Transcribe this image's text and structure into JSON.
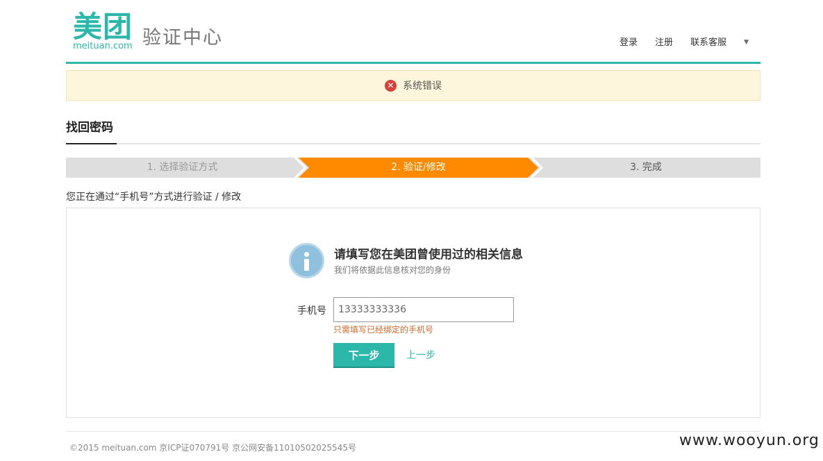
{
  "header": {
    "logo_cn": "美团",
    "logo_en": "meituan.com",
    "site_title": "验证中心",
    "nav": {
      "login": "登录",
      "register": "注册",
      "support": "联系客服"
    },
    "accent_color": "#2bb8aa"
  },
  "alert": {
    "icon": "error-circle-icon",
    "message": "系统错误"
  },
  "page": {
    "title": "找回密码",
    "description": "您正在通过“手机号”方式进行验证 / 修改"
  },
  "steps": [
    {
      "label": "1. 选择验证方式",
      "state": "done"
    },
    {
      "label": "2. 验证/修改",
      "state": "active"
    },
    {
      "label": "3. 完成",
      "state": "pending"
    }
  ],
  "step_active_color": "#ff8a00",
  "form": {
    "icon": "info-icon",
    "heading": "请填写您在美团曾使用过的相关信息",
    "subheading": "我们将依据此信息核对您的身份",
    "phone_label": "手机号",
    "phone_value": "13333333336",
    "hint": "只需填写已经绑定的手机号",
    "next_button": "下一步",
    "prev_link": "上一步"
  },
  "footer": {
    "copyright": "©2015 meituan.com 京ICP证070791号 京公网安备11010502025545号"
  },
  "watermark": "www.wooyun.org"
}
